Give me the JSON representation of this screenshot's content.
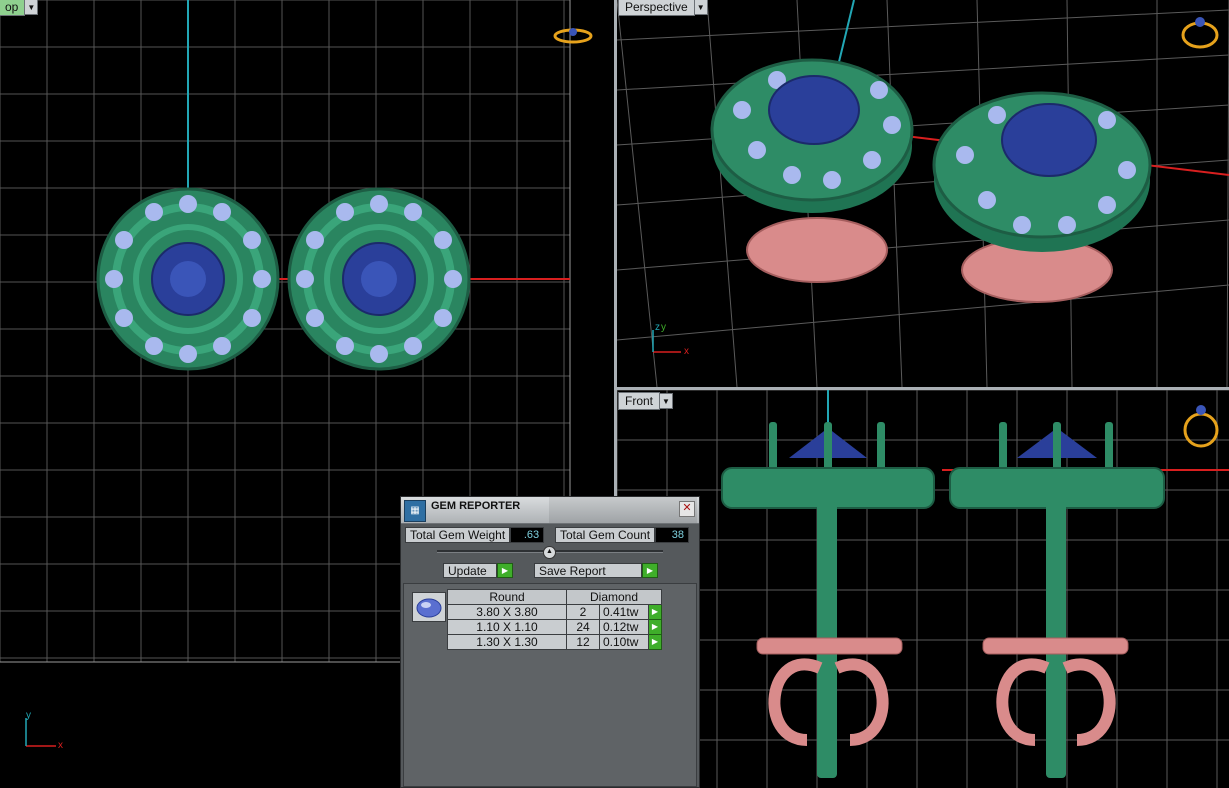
{
  "viewports": {
    "top": {
      "label": "Top",
      "label_visible": "op",
      "axis_x": "x",
      "axis_y": "y"
    },
    "perspective": {
      "label": "Perspective",
      "axis_x": "x",
      "axis_y": "y",
      "axis_z": "z"
    },
    "front": {
      "label": "Front"
    }
  },
  "gem_reporter": {
    "title": "GEM REPORTER",
    "close_symbol": "✕",
    "total_weight_label": "Total Gem Weight",
    "total_weight_value": ".63",
    "total_count_label": "Total Gem Count",
    "total_count_value": "38",
    "update_label": "Update",
    "save_report_label": "Save Report",
    "table": {
      "shape_header": "Round",
      "material_header": "Diamond",
      "rows": [
        {
          "size": "3.80 X 3.80",
          "count": "2",
          "weight": "0.41tw"
        },
        {
          "size": "1.10 X 1.10",
          "count": "24",
          "weight": "0.12tw"
        },
        {
          "size": "1.30 X 1.30",
          "count": "12",
          "weight": "0.10tw"
        }
      ]
    }
  },
  "colors": {
    "metal_green": "#2e8c66",
    "metal_pink": "#d98b8b",
    "gem_blue": "#2a3f9a",
    "accent_diamond": "#a9b9ee",
    "grid": "#5a5a5a",
    "axis_red": "#d81f1f",
    "axis_cyan": "#22a7b5",
    "ring_gold": "#e6a21c"
  },
  "icons": [
    "ring-icon",
    "dropdown-arrow-icon",
    "play-icon",
    "close-icon",
    "gem-icon"
  ]
}
